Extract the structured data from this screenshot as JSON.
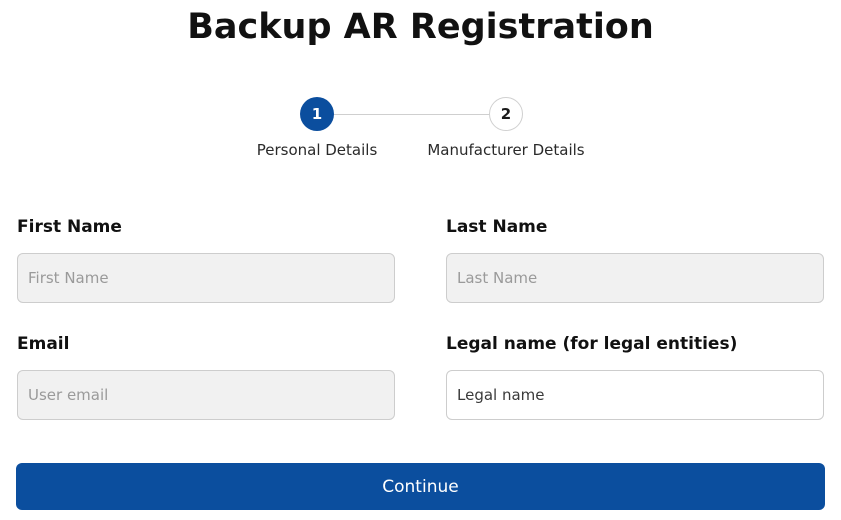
{
  "page": {
    "title": "Backup AR Registration"
  },
  "stepper": {
    "steps": [
      {
        "number": "1",
        "label": "Personal Details",
        "state": "active"
      },
      {
        "number": "2",
        "label": "Manufacturer Details",
        "state": "inactive"
      }
    ],
    "active_color": "#0b4e9e"
  },
  "form": {
    "first_name": {
      "label": "First Name",
      "placeholder": "First Name",
      "value": ""
    },
    "last_name": {
      "label": "Last Name",
      "placeholder": "Last Name",
      "value": ""
    },
    "email": {
      "label": "Email",
      "placeholder": "User email",
      "value": ""
    },
    "legal_name": {
      "label": "Legal name (for legal entities)",
      "placeholder": "Legal name",
      "value": ""
    }
  },
  "actions": {
    "continue_label": "Continue",
    "button_color": "#0b4e9e"
  }
}
